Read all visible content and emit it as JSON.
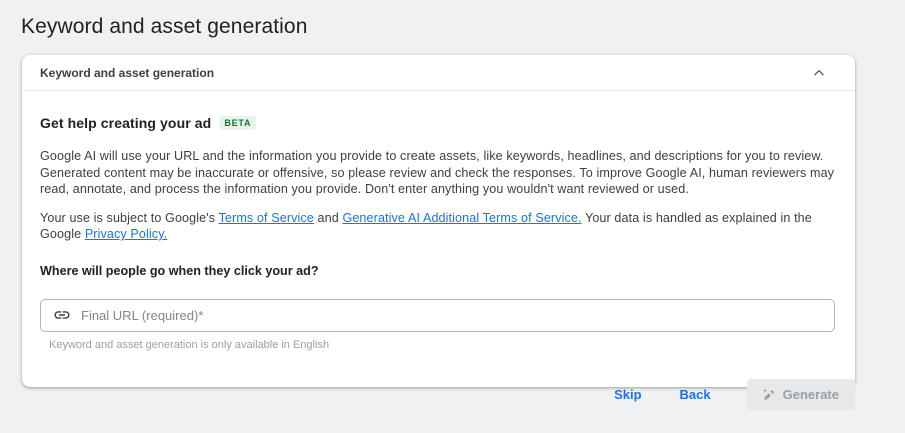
{
  "page": {
    "title": "Keyword and asset generation"
  },
  "card": {
    "header_title": "Keyword and asset generation",
    "section": {
      "heading": "Get help creating your ad",
      "beta_badge": "BETA",
      "disclaimer": "Google AI will use your URL and the information you provide to create assets, like keywords, headlines, and descriptions for you to review. Generated content may be inaccurate or offensive, so please review and check the responses. To improve Google AI, human reviewers may read, annotate, and process the information you provide. Don't enter anything you wouldn't want reviewed or used.",
      "terms": {
        "prefix": "Your use is subject to Google's ",
        "tos_link": "Terms of Service",
        "middle": " and ",
        "genai_link": "Generative AI Additional Terms of Service.",
        "suffix": " Your data is handled as explained in the Google ",
        "privacy_link": "Privacy Policy."
      },
      "question": "Where will people go when they click your ad?",
      "url_input": {
        "value": "",
        "placeholder": "Final URL (required)*"
      },
      "helper": "Keyword and asset generation is only available in English"
    }
  },
  "footer": {
    "skip_label": "Skip",
    "back_label": "Back",
    "generate_label": "Generate"
  },
  "colors": {
    "link_blue": "#1a73e8",
    "beta_bg": "#e6f4ea",
    "beta_text": "#137333",
    "page_bg": "#f0f1f2"
  },
  "icons": {
    "collapse": "chevron-up-icon",
    "url": "link-icon",
    "generate": "pen-spark-icon"
  }
}
